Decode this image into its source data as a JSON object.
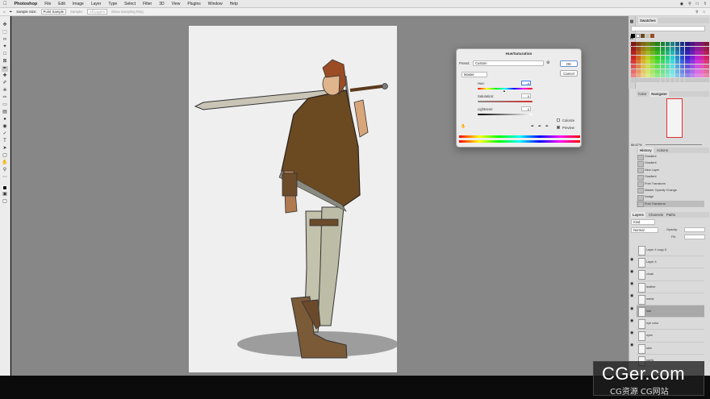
{
  "menubar": {
    "app_name": "Photoshop",
    "items": [
      "File",
      "Edit",
      "Image",
      "Layer",
      "Type",
      "Select",
      "Filter",
      "3D",
      "View",
      "Plugins",
      "Window",
      "Help"
    ]
  },
  "options_bar": {
    "sample_size_label": "Sample Size:",
    "sample_size_value": "Point Sample",
    "sample_label": "Sample:",
    "sample_value": "All Layers",
    "show_ring_label": "Show Sampling Ring"
  },
  "dialog": {
    "title": "Hue/Saturation",
    "preset_label": "Preset:",
    "preset_value": "Custom",
    "ok_label": "OK",
    "cancel_label": "Cancel",
    "channel_value": "Master",
    "hue_label": "Hue:",
    "hue_value": "-4",
    "saturation_label": "Saturation:",
    "saturation_value": "0",
    "lightness_label": "Lightness:",
    "lightness_value": "0",
    "colorize_label": "Colorize",
    "preview_label": "Preview",
    "colorize_checked": false,
    "preview_checked": true
  },
  "panels": {
    "swatches_tab": "Swatches",
    "navigator_tabs": [
      "Color",
      "Navigator"
    ],
    "zoom_value": "66.67%",
    "history_tabs": [
      "History",
      "Actions"
    ],
    "history_items": [
      "Gradient",
      "Gradient",
      "New Layer",
      "Gradient",
      "Free Transform",
      "Master Opacity Change",
      "Nudge",
      "Free Transform"
    ],
    "layers_tabs": [
      "Layers",
      "Channels",
      "Paths"
    ],
    "layers_kind": "Kind",
    "layers_blend": "Normal",
    "layers_opacity_label": "Opacity:",
    "layers_fill_label": "Fill:",
    "layer_items": [
      "Layer 4 copy 8",
      "Layer 4",
      "cloak",
      "leather",
      "metal",
      "hair",
      "eye color",
      "eyes",
      "skin",
      "pants"
    ],
    "selected_layer_index": 5
  },
  "watermark": {
    "brand": "CGer.com",
    "sub": "CG资源 CG网站"
  },
  "colors": {
    "workspace": "#878787",
    "document": "#efefef",
    "accent": "#3b7df0"
  }
}
